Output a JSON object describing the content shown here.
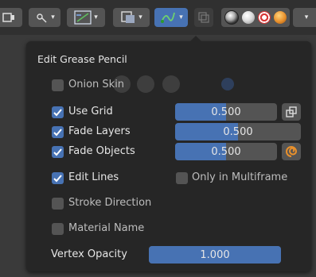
{
  "panel": {
    "title": "Edit Grease Pencil"
  },
  "options": {
    "onion_skin": {
      "label": "Onion Skin",
      "checked": false
    },
    "use_grid": {
      "label": "Use Grid",
      "checked": true,
      "value": "0.500",
      "fraction": 0.5
    },
    "fade_layers": {
      "label": "Fade Layers",
      "checked": true,
      "value": "0.500",
      "fraction": 0.5
    },
    "fade_objects": {
      "label": "Fade Objects",
      "checked": true,
      "value": "0.500",
      "fraction": 0.5
    },
    "edit_lines": {
      "label": "Edit Lines",
      "checked": true
    },
    "only_in_multiframe": {
      "label": "Only in Multiframe",
      "checked": false
    },
    "stroke_direction": {
      "label": "Stroke Direction",
      "checked": false
    },
    "material_name": {
      "label": "Material Name",
      "checked": false
    },
    "vertex_opacity": {
      "label": "Vertex Opacity",
      "value": "1.000",
      "fraction": 1.0
    }
  },
  "header_icons": [
    "select-mode-icon",
    "transform-pivot-icon",
    "overlays-icon",
    "grease-pencil-overlay-icon",
    "xray-icon",
    "wireframe-shading-icon",
    "solid-shading-icon",
    "material-preview-icon",
    "rendered-shading-icon"
  ],
  "colors": {
    "accent": "#4772b3",
    "panel_bg": "#262626",
    "widget_bg": "#545454",
    "text": "#e6e6e6",
    "orange_icon": "#e8902c"
  }
}
